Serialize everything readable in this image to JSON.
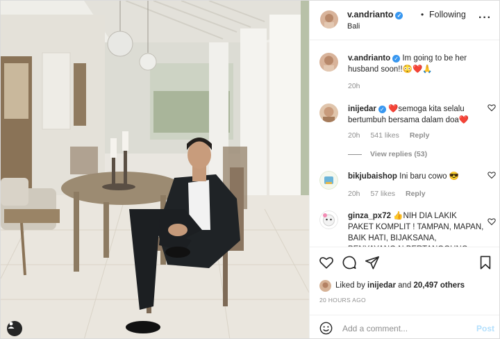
{
  "post": {
    "username": "v.andrianto",
    "follow_status": "Following",
    "location": "Bali",
    "more_icon": "more-options-icon"
  },
  "caption": {
    "username": "v.andrianto",
    "text": "Im going to be her husband soon!!😳❤️🙏",
    "time": "20h"
  },
  "comments": [
    {
      "username": "inijedar",
      "verified": true,
      "text": "❤️semoga kita selalu bertumbuh bersama dalam doa❤️",
      "time": "20h",
      "likes": "541 likes",
      "reply_label": "Reply",
      "view_replies": "View replies (53)"
    },
    {
      "username": "bikjubaishop",
      "verified": false,
      "text": "Ini baru cowo 😎",
      "time": "20h",
      "likes": "57 likes",
      "reply_label": "Reply"
    },
    {
      "username": "ginza_px72",
      "verified": false,
      "text": "👍NIH DIA LAKIK PAKET KOMPLIT ! TAMPAN, MAPAN, BAIK HATI, BIJAKSANA, PENYAYANG N BERTANGGUNG JAWAB. COCOK"
    }
  ],
  "liked_by": {
    "prefix": "Liked by ",
    "user": "inijedar",
    "middle": " and ",
    "others": "20,497 others"
  },
  "timestamp": "20 HOURS AGO",
  "add_comment": {
    "placeholder": "Add a comment...",
    "post_label": "Post"
  },
  "colors": {
    "verified": "#3897f0",
    "heart_red": "#ed4956",
    "muted": "#8e8e8e",
    "post_disabled": "#b2dffc"
  }
}
